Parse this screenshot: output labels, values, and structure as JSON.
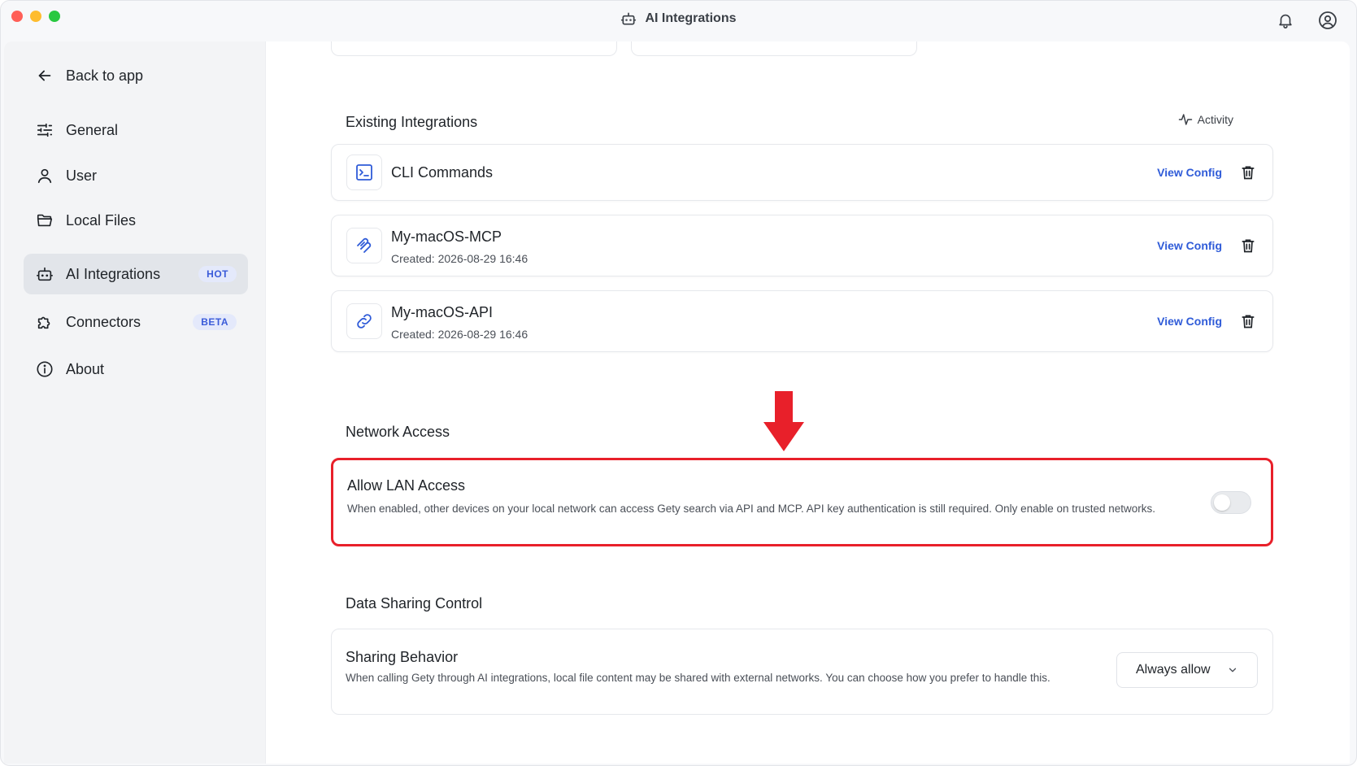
{
  "window": {
    "title": "AI Integrations"
  },
  "sidebar": {
    "items": [
      {
        "label": "Back to app",
        "icon": "arrow-left-icon"
      },
      {
        "label": "General",
        "icon": "sliders-icon"
      },
      {
        "label": "User",
        "icon": "user-icon"
      },
      {
        "label": "Local Files",
        "icon": "folder-icon"
      },
      {
        "label": "AI Integrations",
        "icon": "robot-icon",
        "badge": "HOT",
        "active": true
      },
      {
        "label": "Connectors",
        "icon": "puzzle-icon",
        "badge": "BETA"
      },
      {
        "label": "About",
        "icon": "info-icon"
      }
    ]
  },
  "existing": {
    "title": "Existing Integrations",
    "activity_label": "Activity",
    "items": [
      {
        "name": "CLI Commands",
        "icon": "terminal-icon",
        "action": "View Config"
      },
      {
        "name": "My-macOS-MCP",
        "created": "Created: 2026-08-29 16:46",
        "icon": "mcp-icon",
        "action": "View Config"
      },
      {
        "name": "My-macOS-API",
        "created": "Created: 2026-08-29 16:46",
        "icon": "link-icon",
        "action": "View Config"
      }
    ]
  },
  "network": {
    "title": "Network Access",
    "lan_title": "Allow LAN Access",
    "lan_desc": "When enabled, other devices on your local network can access Gety search via API and MCP. API key authentication is still required. Only enable on trusted networks.",
    "lan_enabled": false
  },
  "sharing": {
    "title": "Data Sharing Control",
    "behavior_title": "Sharing Behavior",
    "behavior_desc": "When calling Gety through AI integrations, local file content may be shared with external networks. You can choose how you prefer to handle this.",
    "selected": "Always allow"
  },
  "colors": {
    "accent": "#2f5bd8",
    "highlight": "#e8202a"
  }
}
